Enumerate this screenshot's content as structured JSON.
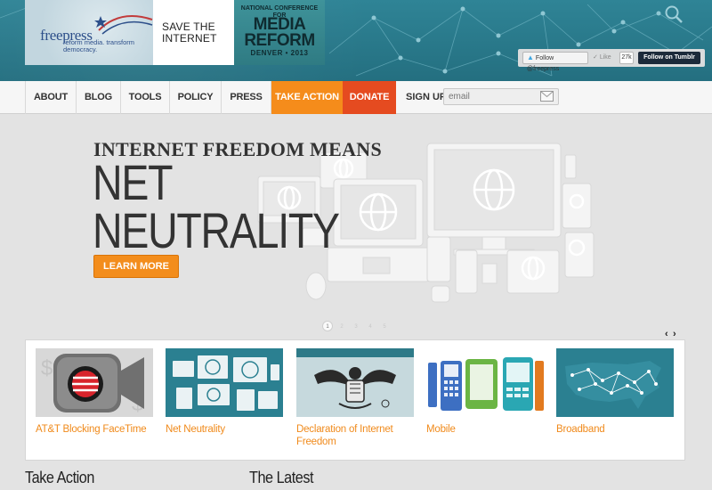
{
  "header": {
    "logo": {
      "word": "freepress",
      "tagline": "reform media. transform democracy."
    },
    "save_banner": "SAVE THE INTERNET",
    "conference": {
      "line1": "NATIONAL CONFERENCE FOR",
      "line2": "MEDIA REFORM",
      "line3": "DENVER • 2013"
    },
    "social": {
      "twitter_label": "Follow @freepress",
      "like_label": "Like",
      "like_count": "27k",
      "tumblr_label": "Follow on Tumblr"
    }
  },
  "nav": {
    "items": [
      "ABOUT",
      "BLOG",
      "TOOLS",
      "POLICY",
      "PRESS",
      "TAKE ACTION",
      "DONATE"
    ],
    "signup_label": "SIGN UP:",
    "email_placeholder": "email"
  },
  "hero": {
    "kicker": "INTERNET FREEDOM MEANS",
    "headline_line1": "NET",
    "headline_line2": "NEUTRALITY",
    "button": "LEARN MORE",
    "pages": [
      "1",
      "2",
      "3",
      "4",
      "5"
    ],
    "active_page": 1
  },
  "carousel_arrows": {
    "prev": "‹",
    "next": "›"
  },
  "cards": [
    {
      "title": "AT&T Blocking FaceTime"
    },
    {
      "title": "Net Neutrality"
    },
    {
      "title": "Declaration of Internet Freedom"
    },
    {
      "title": "Mobile"
    },
    {
      "title": "Broadband"
    }
  ],
  "sections": {
    "take_action": "Take Action",
    "latest": "The Latest"
  },
  "colors": {
    "accent_orange": "#f58c1b",
    "donate_red": "#e54b20",
    "header_teal": "#2a7a8c"
  }
}
